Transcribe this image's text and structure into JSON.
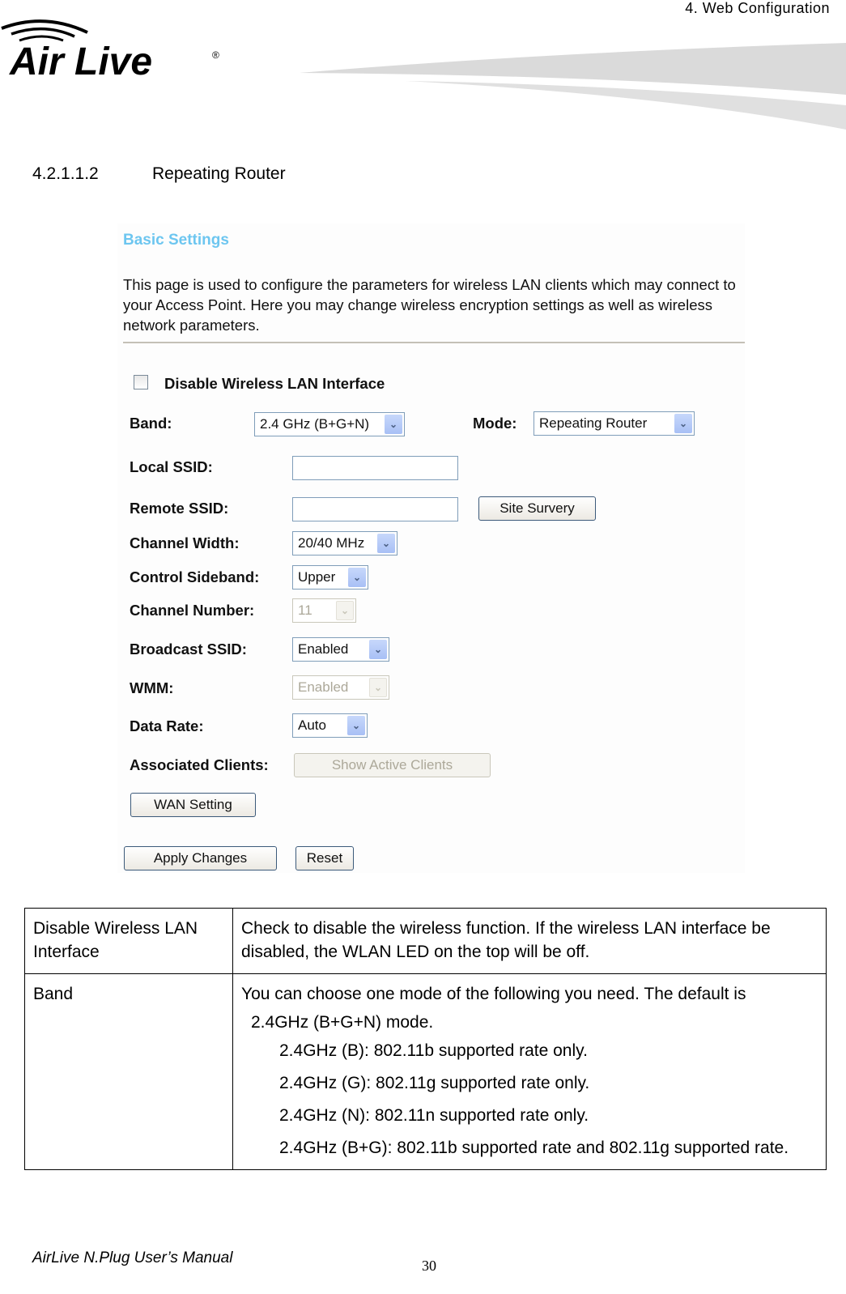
{
  "header": {
    "chapter": "4.  Web  Configuration",
    "logo_text": "Air Live",
    "logo_icon": "wireless-waves-icon"
  },
  "section": {
    "number": "4.2.1.1.2",
    "title": "Repeating Router"
  },
  "screenshot": {
    "heading": "Basic Settings",
    "description": "This page is used to configure the parameters for wireless LAN clients which may connect to your Access Point. Here you may change wireless encryption settings as well as wireless network parameters.",
    "disable_wlan": {
      "label": "Disable Wireless LAN Interface",
      "checked": false
    },
    "band": {
      "label": "Band:",
      "value": "2.4 GHz (B+G+N)"
    },
    "mode": {
      "label": "Mode:",
      "value": "Repeating Router"
    },
    "local_ssid": {
      "label": "Local SSID:",
      "value": ""
    },
    "remote_ssid": {
      "label": "Remote SSID:",
      "value": ""
    },
    "site_survey_button": "Site Survery",
    "channel_width": {
      "label": "Channel Width:",
      "value": "20/40 MHz"
    },
    "control_sideband": {
      "label": "Control Sideband:",
      "value": "Upper"
    },
    "channel_number": {
      "label": "Channel Number:",
      "value": "11",
      "disabled": true
    },
    "broadcast_ssid": {
      "label": "Broadcast SSID:",
      "value": "Enabled"
    },
    "wmm": {
      "label": "WMM:",
      "value": "Enabled",
      "disabled": true
    },
    "data_rate": {
      "label": "Data Rate:",
      "value": "Auto"
    },
    "associated_clients": {
      "label": "Associated Clients:",
      "button": "Show Active Clients",
      "disabled": true
    },
    "wan_setting_button": "WAN Setting",
    "apply_button": "Apply Changes",
    "reset_button": "Reset",
    "colors": {
      "heading": "#6dc6f0",
      "select_border": "#7f9db9",
      "dropdown_arrow_bg": "#b8ccf8"
    }
  },
  "table": {
    "rows": [
      {
        "term": "Disable Wireless LAN Interface",
        "description": "Check to disable the wireless function. If the wireless LAN interface be disabled, the WLAN LED on the top will be off."
      },
      {
        "term": "Band",
        "description": "You can choose one mode of the following you need. The default is",
        "default_line": "2.4GHz (B+G+N) mode.",
        "options": [
          "2.4GHz (B): 802.11b supported rate only.",
          "2.4GHz (G): 802.11g supported rate only.",
          "2.4GHz (N): 802.11n supported rate only.",
          "2.4GHz (B+G): 802.11b supported rate and 802.11g supported rate."
        ]
      }
    ]
  },
  "footer": {
    "manual": "AirLive N.Plug User’s Manual",
    "page": "30"
  }
}
